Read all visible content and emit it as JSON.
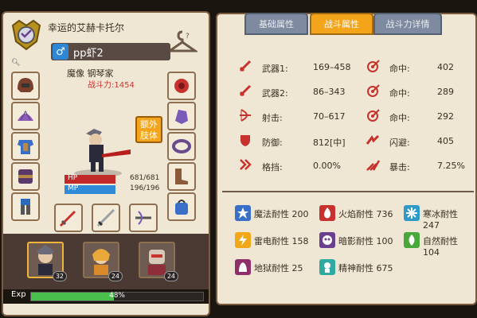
{
  "profile": {
    "title": "幸运的艾赫卡托尔",
    "name": "pp虾2",
    "gender_symbol": "♂",
    "class_name": "魔像 钢琴家",
    "power_label": "战斗力:1454"
  },
  "extra_body_label": "额外\n肢体",
  "vitals": {
    "hp_label": "HP",
    "hp_value": "681/681",
    "hp_fraction": 1.0,
    "mp_label": "MP",
    "mp_value": "196/196",
    "mp_fraction": 1.0
  },
  "pets": [
    {
      "level": "32"
    },
    {
      "level": "24"
    },
    {
      "level": "24"
    }
  ],
  "exp": {
    "label": "Exp",
    "percent_text": "48%",
    "fraction": 0.48
  },
  "tabs": [
    {
      "label": "基础属性"
    },
    {
      "label": "战斗属性"
    },
    {
      "label": "战斗力详情"
    }
  ],
  "combat_stats": [
    {
      "label": "武器1:",
      "value": "169–458",
      "icon": "sword-icon"
    },
    {
      "label": "命中:",
      "value": "402",
      "icon": "target-icon"
    },
    {
      "label": "武器2:",
      "value": "86–343",
      "icon": "sword-icon"
    },
    {
      "label": "命中:",
      "value": "289",
      "icon": "target-icon"
    },
    {
      "label": "射击:",
      "value": "70–617",
      "icon": "bow-icon"
    },
    {
      "label": "命中:",
      "value": "292",
      "icon": "target-icon"
    },
    {
      "label": "防御:",
      "value": "812[中]",
      "icon": "shield-icon"
    },
    {
      "label": "闪避:",
      "value": "405",
      "icon": "dodge-icon"
    },
    {
      "label": "格挡:",
      "value": "0.00%",
      "icon": "block-icon"
    },
    {
      "label": "暴击:",
      "value": "7.25%",
      "icon": "crit-icon"
    }
  ],
  "resistances": [
    {
      "label": "魔法耐性 200",
      "icon": "magic-icon",
      "color": "#3a6fc8"
    },
    {
      "label": "火焰耐性 736",
      "icon": "fire-icon",
      "color": "#c8322e"
    },
    {
      "label": "寒冰耐性 247",
      "icon": "ice-icon",
      "color": "#2e9ac8"
    },
    {
      "label": "雷电耐性 158",
      "icon": "lightning-icon",
      "color": "#f0a81a"
    },
    {
      "label": "暗影耐性 100",
      "icon": "shadow-icon",
      "color": "#6a3f8e"
    },
    {
      "label": "自然耐性 104",
      "icon": "nature-icon",
      "color": "#4aa83a"
    },
    {
      "label": "地狱耐性 25",
      "icon": "hell-icon",
      "color": "#8e2e6a"
    },
    {
      "label": "精神耐性 675",
      "icon": "spirit-icon",
      "color": "#2eaaa0"
    }
  ],
  "colors": {
    "hp": "#c22a2a",
    "mp": "#2f8ad8",
    "accent": "#f3a41a",
    "stat_icon": "#c8322e"
  }
}
